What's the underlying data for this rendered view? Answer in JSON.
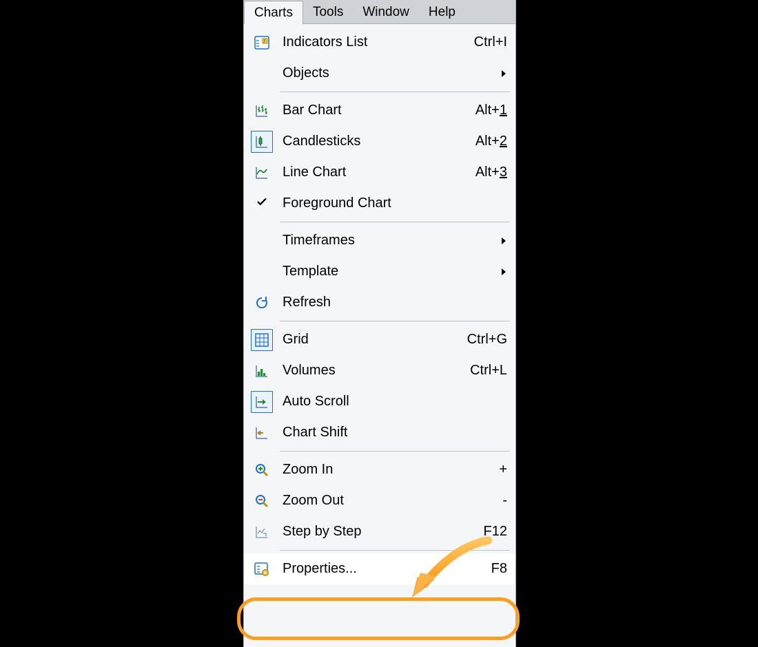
{
  "menubar": {
    "items": [
      "Charts",
      "Tools",
      "Window",
      "Help"
    ],
    "activeIndex": 0
  },
  "menu": {
    "items": [
      {
        "id": "indicators-list",
        "label": "Indicators List",
        "shortcut": "Ctrl+I",
        "icon": "indicators"
      },
      {
        "id": "objects",
        "label": "Objects",
        "submenu": true
      },
      {
        "sep": true
      },
      {
        "id": "bar-chart",
        "label": "Bar Chart",
        "shortcutPrefix": "Alt+",
        "shortcutKey": "1",
        "icon": "bar-chart"
      },
      {
        "id": "candlesticks",
        "label": "Candlesticks",
        "shortcutPrefix": "Alt+",
        "shortcutKey": "2",
        "icon": "candlesticks",
        "selected": true
      },
      {
        "id": "line-chart",
        "label": "Line Chart",
        "shortcutPrefix": "Alt+",
        "shortcutKey": "3",
        "icon": "line-chart"
      },
      {
        "id": "foreground-chart",
        "label": "Foreground Chart",
        "check": true
      },
      {
        "sep": true
      },
      {
        "id": "timeframes",
        "label": "Timeframes",
        "submenu": true
      },
      {
        "id": "template",
        "label": "Template",
        "submenu": true
      },
      {
        "id": "refresh",
        "label": "Refresh",
        "icon": "refresh"
      },
      {
        "sep": true
      },
      {
        "id": "grid",
        "label": "Grid",
        "shortcut": "Ctrl+G",
        "icon": "grid",
        "selected": true
      },
      {
        "id": "volumes",
        "label": "Volumes",
        "shortcut": "Ctrl+L",
        "icon": "volumes"
      },
      {
        "id": "auto-scroll",
        "label": "Auto Scroll",
        "icon": "auto-scroll",
        "selected": true
      },
      {
        "id": "chart-shift",
        "label": "Chart Shift",
        "icon": "chart-shift"
      },
      {
        "sep": true
      },
      {
        "id": "zoom-in",
        "label": "Zoom In",
        "shortcut": "+",
        "icon": "zoom-in"
      },
      {
        "id": "zoom-out",
        "label": "Zoom Out",
        "shortcut": "-",
        "icon": "zoom-out"
      },
      {
        "id": "step-by-step",
        "label": "Step by Step",
        "shortcut": "F12",
        "icon": "step"
      },
      {
        "sep": true
      },
      {
        "id": "properties",
        "label": "Properties...",
        "shortcut": "F8",
        "icon": "properties",
        "highlighted": true
      }
    ]
  }
}
